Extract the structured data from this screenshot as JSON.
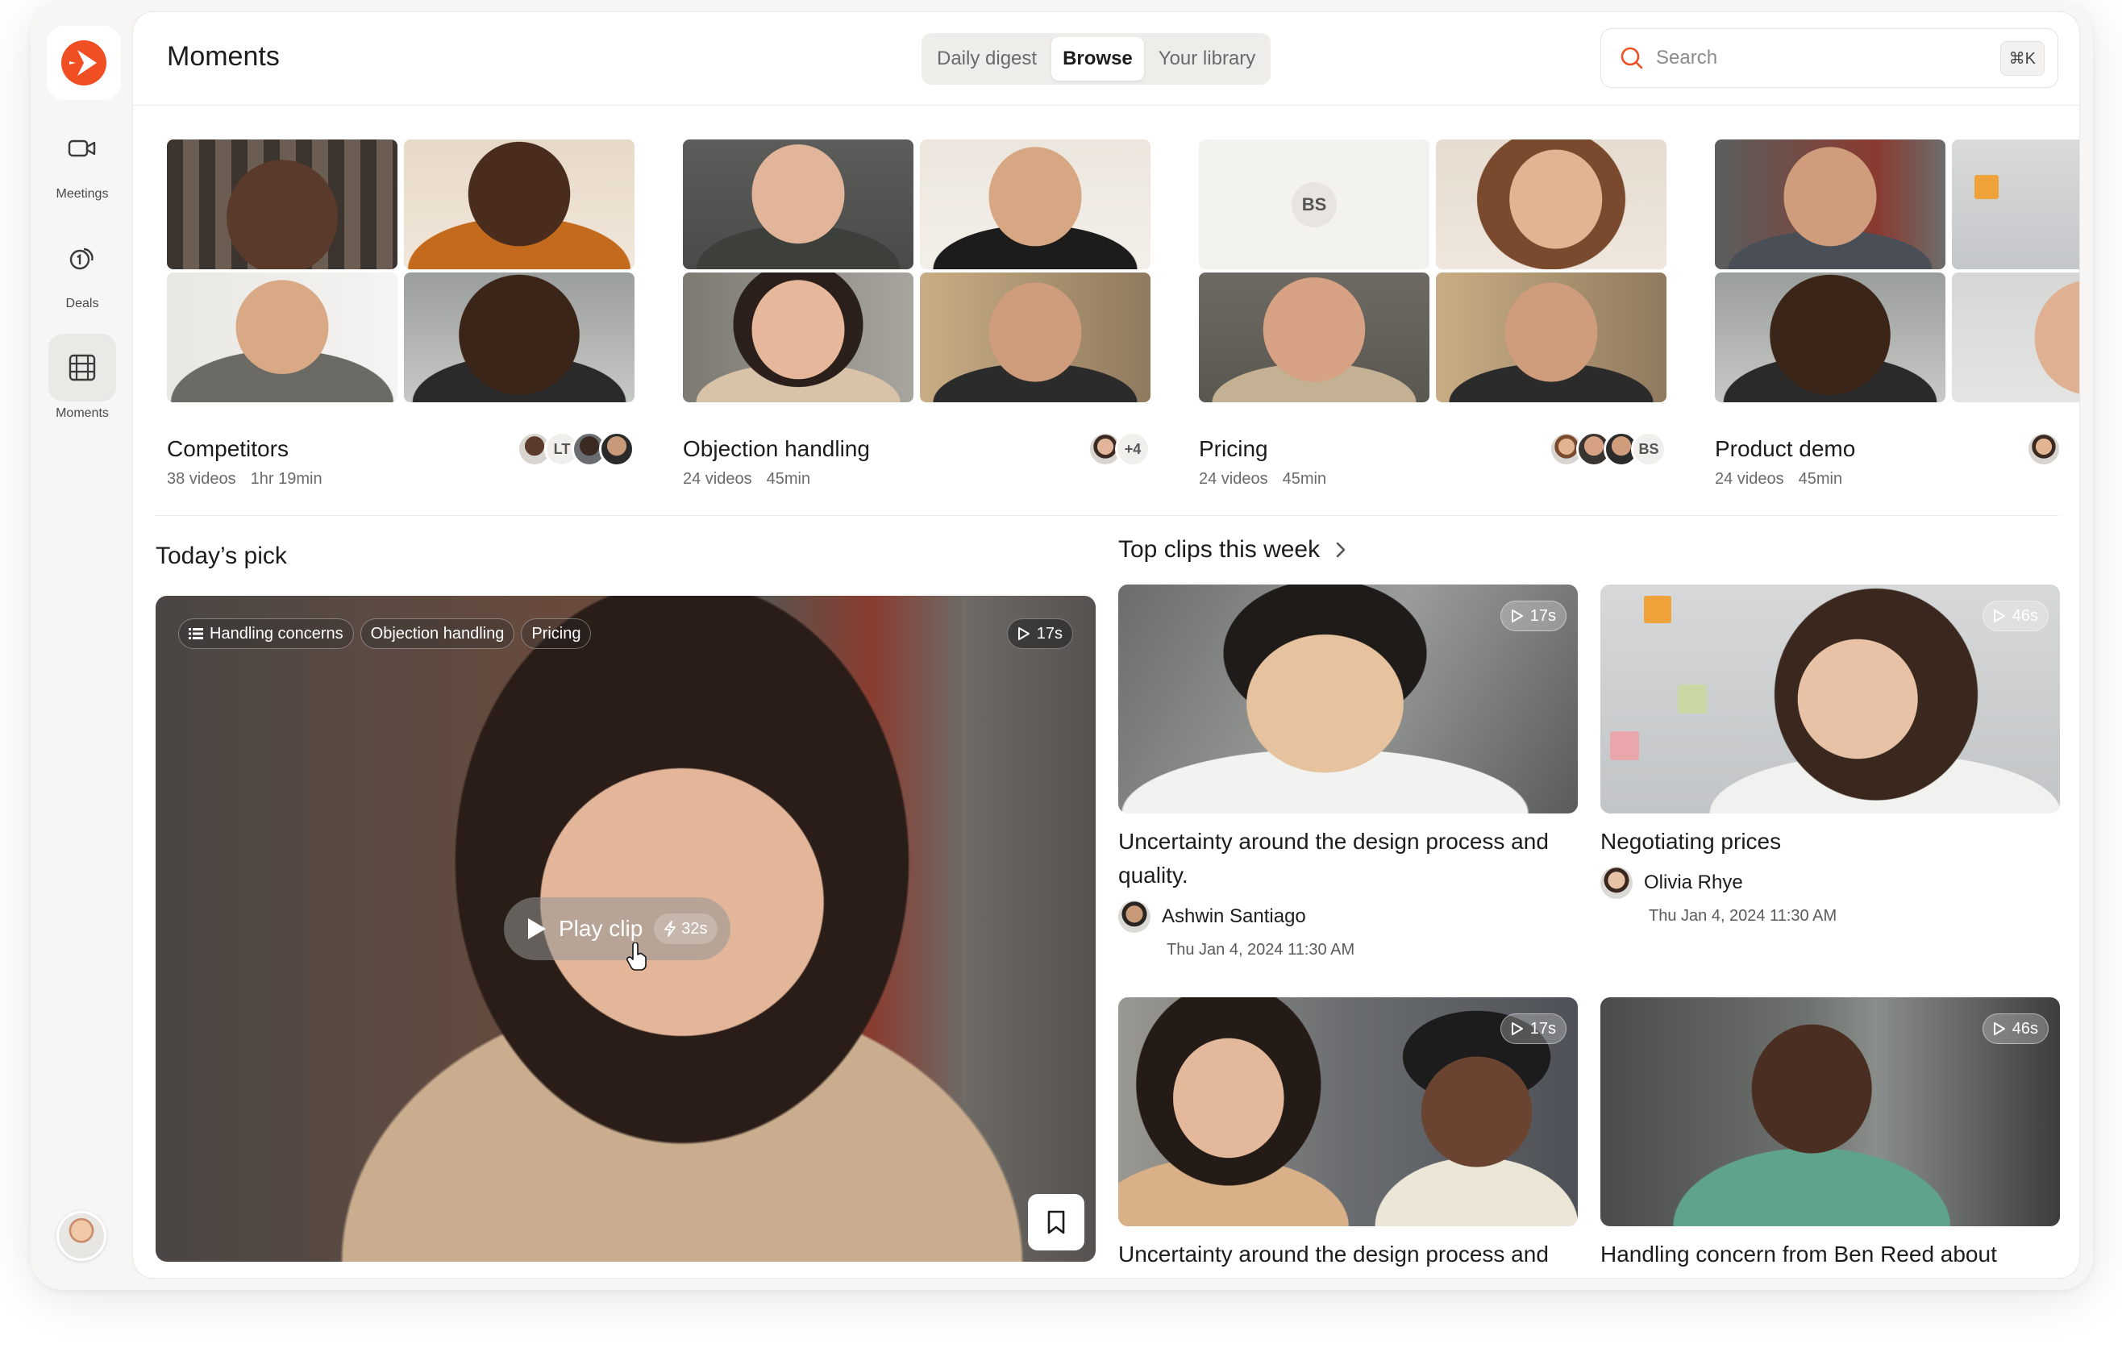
{
  "app": {
    "title": "Moments"
  },
  "nav": [
    {
      "label": "Meetings",
      "icon": "video-camera-icon"
    },
    {
      "label": "Deals",
      "icon": "deals-coin-icon"
    },
    {
      "label": "Moments",
      "icon": "film-grid-icon",
      "active": true
    }
  ],
  "tabs": [
    {
      "label": "Daily digest"
    },
    {
      "label": "Browse",
      "active": true
    },
    {
      "label": "Your library"
    }
  ],
  "search": {
    "placeholder": "Search",
    "shortcut": "⌘K"
  },
  "collections": [
    {
      "title": "Competitors",
      "videos": "38 videos",
      "duration": "1hr 19min",
      "avatars": [
        "LT"
      ]
    },
    {
      "title": "Objection handling",
      "videos": "24 videos",
      "duration": "45min",
      "avatars": [
        "+4"
      ]
    },
    {
      "title": "Pricing",
      "videos": "24 videos",
      "duration": "45min",
      "avatars": [
        "BS"
      ],
      "tile_initials": "BS"
    },
    {
      "title": "Product demo",
      "videos": "24 videos",
      "duration": "45min",
      "avatars": []
    }
  ],
  "todays_pick": {
    "heading": "Today’s pick",
    "tags": [
      "Handling concerns",
      "Objection handling",
      "Pricing"
    ],
    "duration": "17s",
    "play_label": "Play clip",
    "play_duration": "32s"
  },
  "top_clips": {
    "heading": "Top clips this week",
    "items": [
      {
        "duration": "17s",
        "title": "Uncertainty around the design process and quality.",
        "author": "Ashwin Santiago",
        "date": "Thu Jan 4, 2024  11:30 AM"
      },
      {
        "duration": "46s",
        "title": "Negotiating prices",
        "author": "Olivia Rhye",
        "date": "Thu Jan 4, 2024  11:30 AM"
      },
      {
        "duration": "17s",
        "title": "Uncertainty around the design process and"
      },
      {
        "duration": "46s",
        "title": "Handling concern from Ben Reed about"
      }
    ]
  },
  "colors": {
    "brand": "#f04e23",
    "background": "#f7f6f4",
    "text": "#1c1c1e"
  }
}
